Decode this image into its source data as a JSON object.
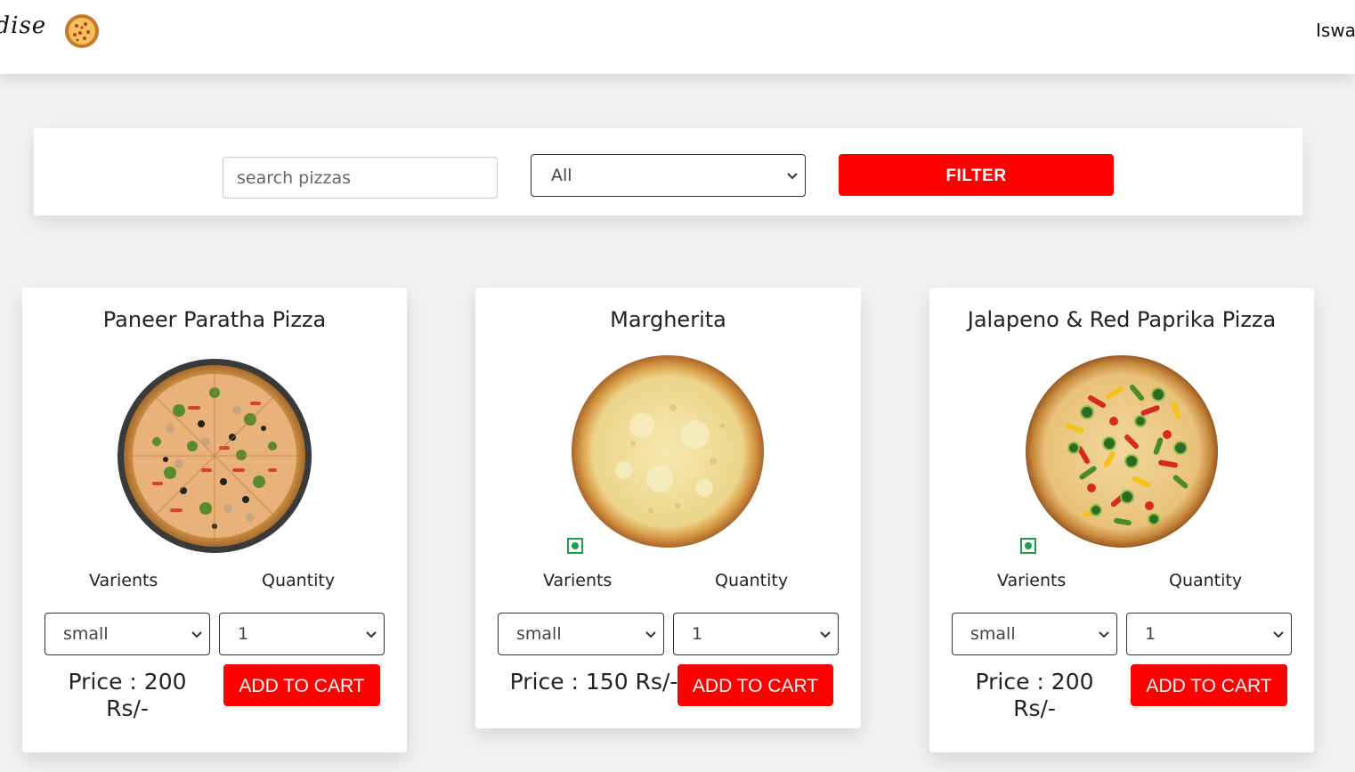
{
  "navbar": {
    "brand": "adise",
    "logo_icon": "pizza-logo-icon",
    "user": "Iswa"
  },
  "filter": {
    "search_placeholder": "search pizzas",
    "search_value": "",
    "category_selected": "All",
    "filter_label": "FILTER"
  },
  "labels": {
    "variants": "Varients",
    "quantity": "Quantity",
    "add_to_cart": "ADD TO CART"
  },
  "pizzas": [
    {
      "name": "Paneer Paratha Pizza",
      "variant": "small",
      "quantity": "1",
      "price_line1": "Price : 200",
      "price_line2": "Rs/-",
      "veg_icon": false
    },
    {
      "name": "Margherita",
      "variant": "small",
      "quantity": "1",
      "price_line1": "Price : 150 Rs/-",
      "price_line2": "",
      "veg_icon": true
    },
    {
      "name": "Jalapeno & Red Paprika Pizza",
      "variant": "small",
      "quantity": "1",
      "price_line1": "Price : 200",
      "price_line2": "Rs/-",
      "veg_icon": true
    }
  ],
  "colors": {
    "accent": "#ff0000",
    "veg_green": "#1f9d4c"
  }
}
